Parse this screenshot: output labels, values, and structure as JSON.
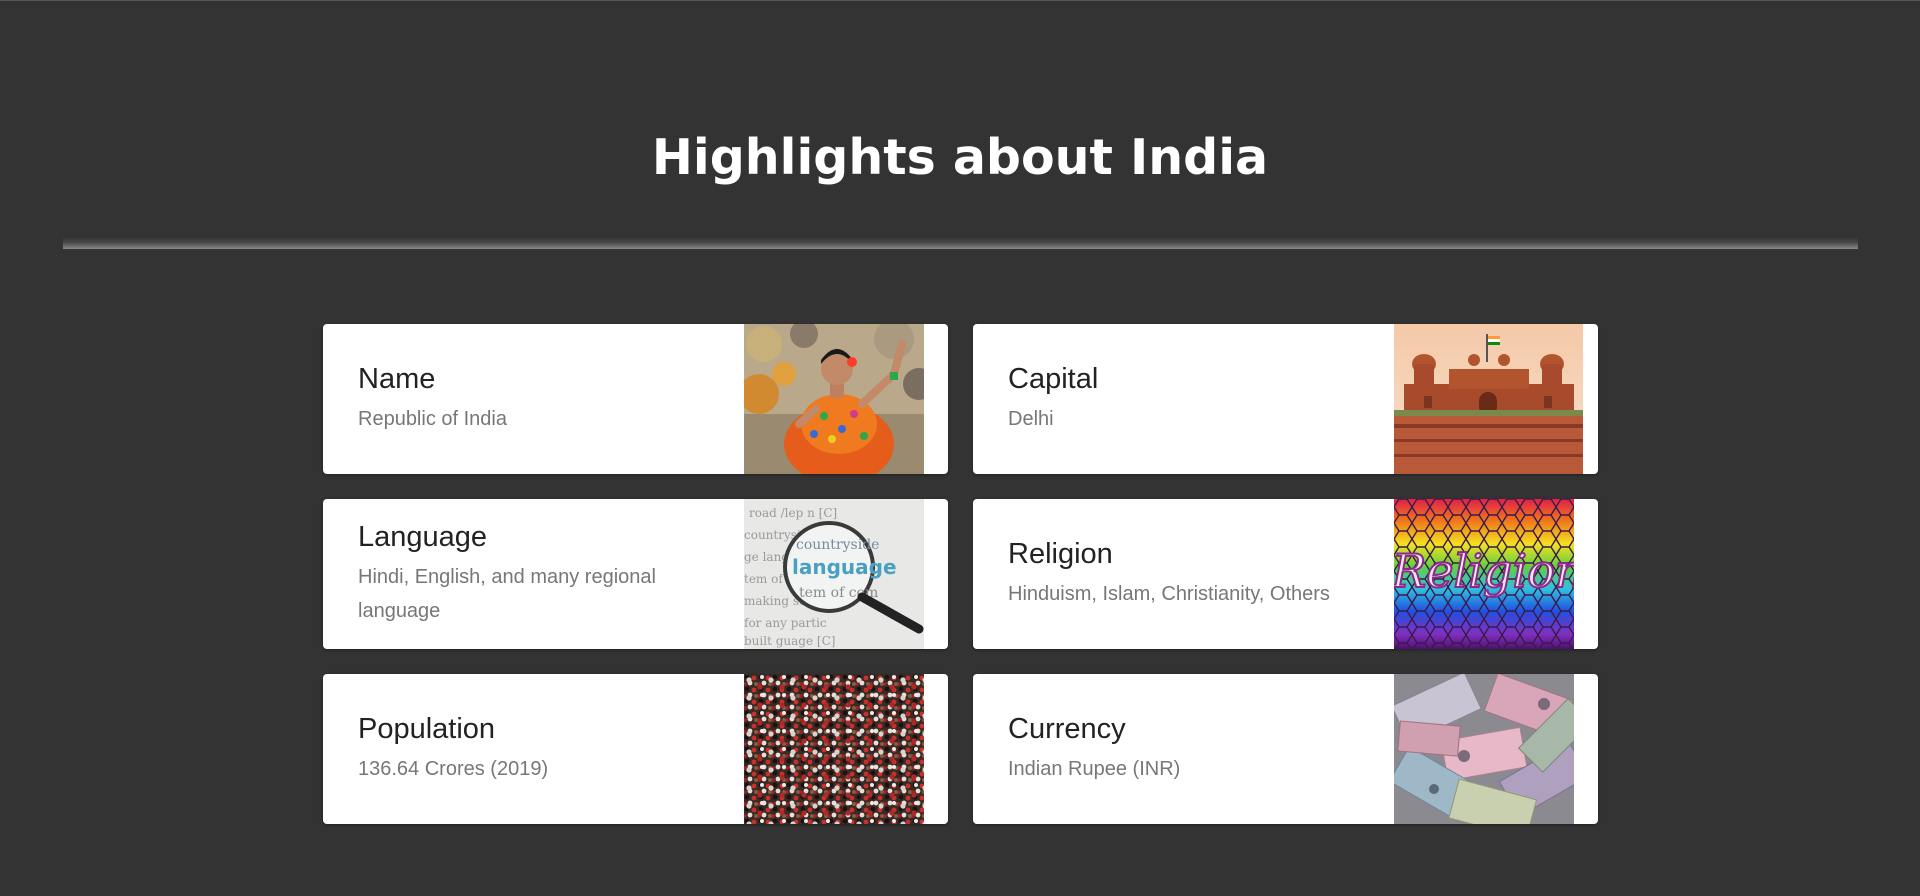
{
  "page": {
    "title": "Highlights about India"
  },
  "cards": [
    {
      "title": "Name",
      "description": "Republic of India",
      "image": "dancer-image"
    },
    {
      "title": "Capital",
      "description": "Delhi",
      "image": "red-fort-image"
    },
    {
      "title": "Language",
      "description": "Hindi, English, and many regional language",
      "image": "magnifier-language-image"
    },
    {
      "title": "Religion",
      "description": "Hinduism, Islam, Christianity, Others",
      "image": "religion-mosaic-image",
      "image_text": "Religion"
    },
    {
      "title": "Population",
      "description": "136.64 Crores (2019)",
      "image": "crowd-image"
    },
    {
      "title": "Currency",
      "description": "Indian Rupee (INR)",
      "image": "banknotes-image"
    }
  ],
  "colors": {
    "background": "#333333",
    "card": "#ffffff",
    "title_text": "#ffffff",
    "card_title": "#222222",
    "card_desc": "#777777"
  }
}
